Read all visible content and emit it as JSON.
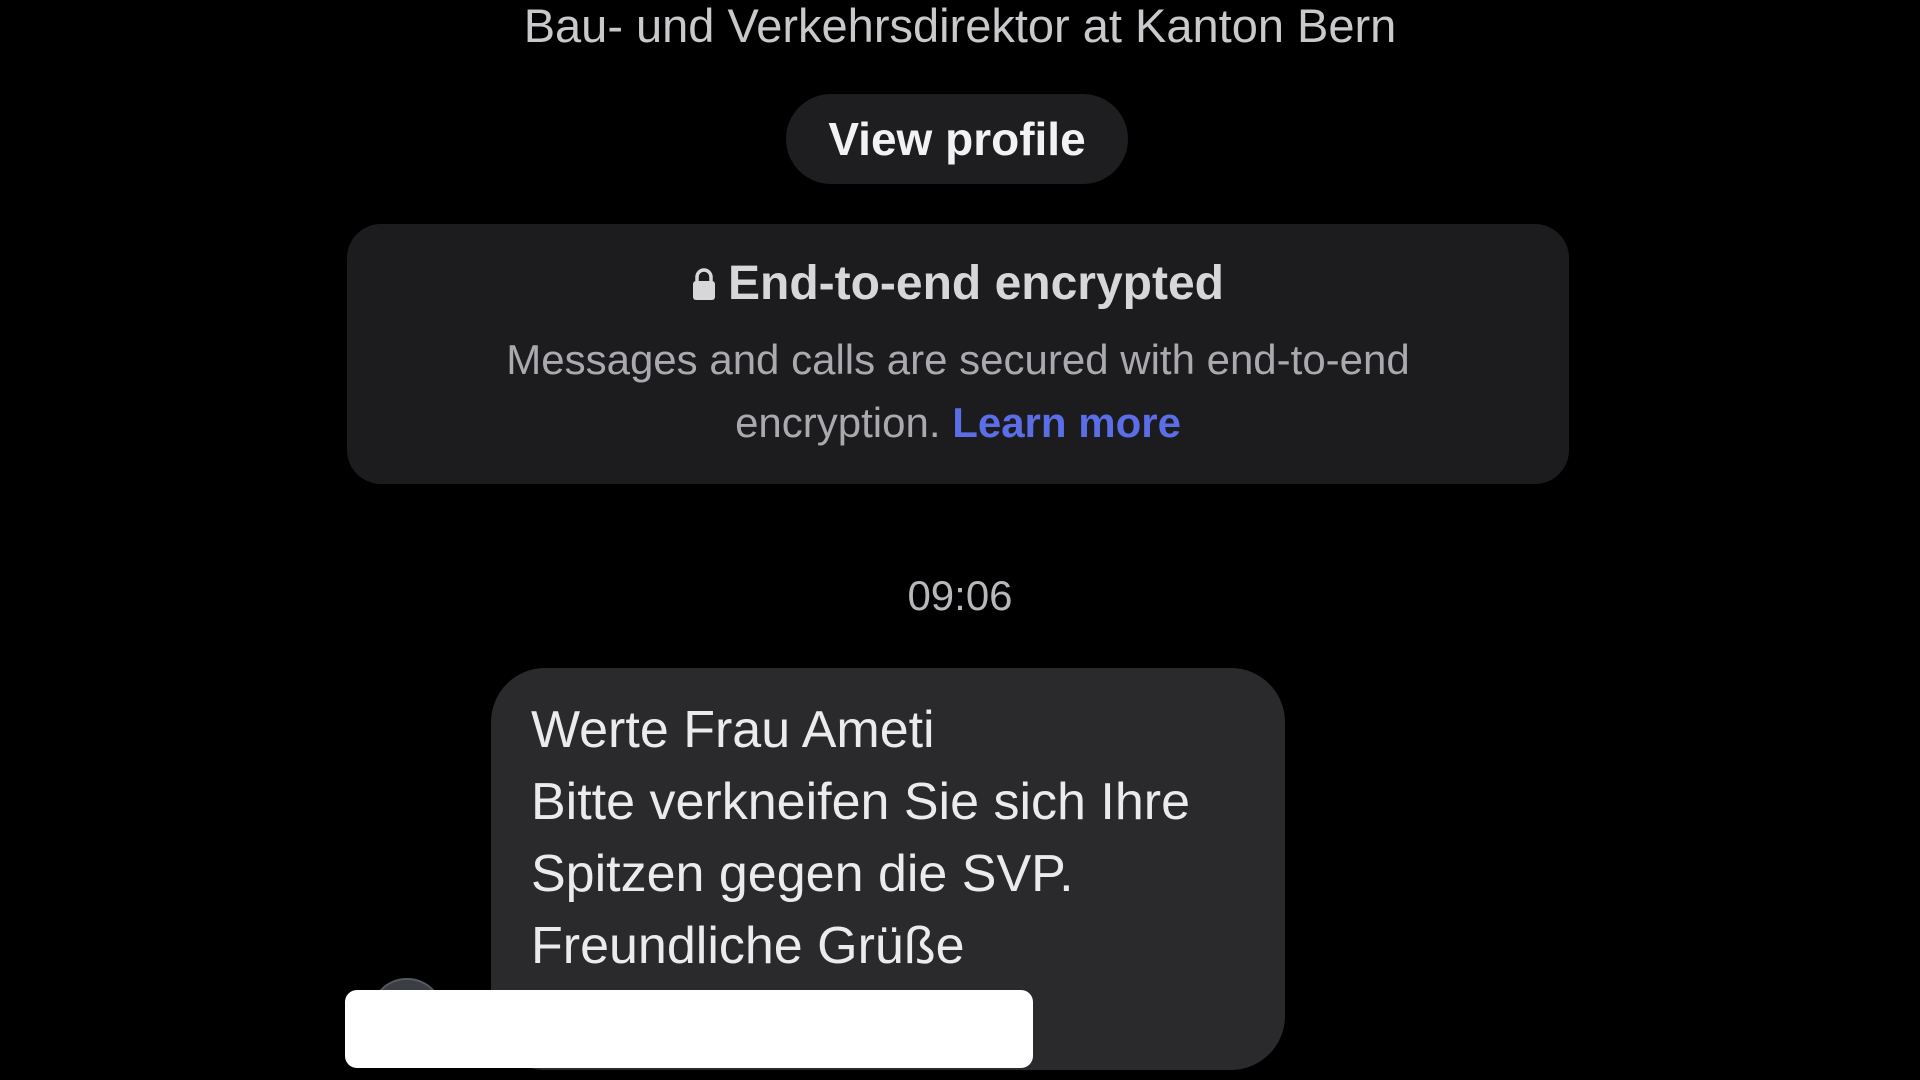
{
  "header": {
    "subtitle": "Bau- und Verkehrsdirektor at Kanton Bern",
    "view_profile_label": "View profile"
  },
  "encryption_notice": {
    "icon": "lock-icon",
    "title": "End-to-end encrypted",
    "body": "Messages and calls are secured with end-to-end encryption.",
    "link_label": "Learn more",
    "link_color": "#5b6ee8"
  },
  "conversation": {
    "timestamp": "09:06",
    "messages": [
      {
        "lines": [
          "Werte Frau Ameti",
          "Bitte verkneifen Sie sich Ihre",
          "Spitzen gegen die SVP.",
          "Freundliche Grüße"
        ]
      }
    ]
  },
  "colors": {
    "background": "#000000",
    "card": "#1c1c1e",
    "bubble": "#2a2a2d",
    "redaction": "#ffffff"
  }
}
